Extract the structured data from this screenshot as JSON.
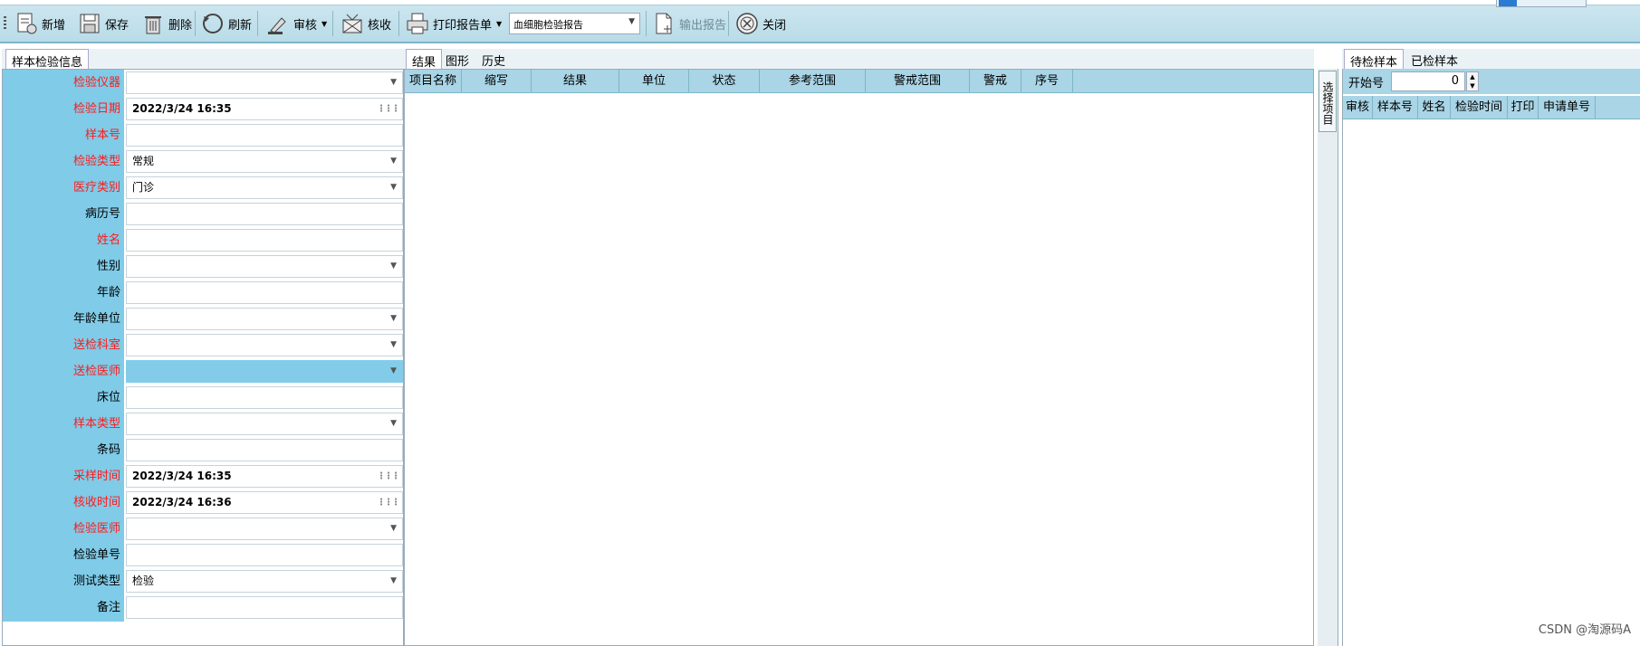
{
  "toolbar": {
    "buttons": [
      {
        "label": "新增",
        "icon": "new-doc-icon"
      },
      {
        "label": "保存",
        "icon": "save-icon"
      },
      {
        "label": "删除",
        "icon": "trash-icon"
      },
      {
        "label": "刷新",
        "icon": "refresh-icon"
      },
      {
        "label": "审核",
        "icon": "review-stamp-icon"
      },
      {
        "label": "核收",
        "icon": "receive-icon"
      },
      {
        "label": "打印报告单",
        "icon": "printer-icon"
      },
      {
        "label": "输出报告",
        "icon": "export-doc-icon"
      },
      {
        "label": "关闭",
        "icon": "close-circle-icon"
      }
    ],
    "report_select": "血细胞检验报告"
  },
  "left": {
    "tab": "样本检验信息",
    "fields": [
      {
        "label": "检验仪器",
        "value": "",
        "required": true,
        "type": "select"
      },
      {
        "label": "检验日期",
        "value": "2022/3/24 16:35",
        "required": true,
        "type": "date"
      },
      {
        "label": "样本号",
        "value": "",
        "required": true,
        "type": "text"
      },
      {
        "label": "检验类型",
        "value": "常规",
        "required": true,
        "type": "select"
      },
      {
        "label": "医疗类别",
        "value": "门诊",
        "required": true,
        "type": "select"
      },
      {
        "label": "病历号",
        "value": "",
        "required": false,
        "type": "text"
      },
      {
        "label": "姓名",
        "value": "",
        "required": true,
        "type": "text"
      },
      {
        "label": "性别",
        "value": "",
        "required": false,
        "type": "select"
      },
      {
        "label": "年龄",
        "value": "",
        "required": false,
        "type": "text"
      },
      {
        "label": "年龄单位",
        "value": "",
        "required": false,
        "type": "select"
      },
      {
        "label": "送检科室",
        "value": "",
        "required": true,
        "type": "select"
      },
      {
        "label": "送检医师",
        "value": "",
        "required": true,
        "type": "select",
        "highlight": true
      },
      {
        "label": "床位",
        "value": "",
        "required": false,
        "type": "text"
      },
      {
        "label": "样本类型",
        "value": "",
        "required": true,
        "type": "select"
      },
      {
        "label": "条码",
        "value": "",
        "required": false,
        "type": "text"
      },
      {
        "label": "采样时间",
        "value": "2022/3/24 16:35",
        "required": true,
        "type": "date"
      },
      {
        "label": "核收时间",
        "value": "2022/3/24 16:36",
        "required": true,
        "type": "date"
      },
      {
        "label": "检验医师",
        "value": "",
        "required": true,
        "type": "select"
      },
      {
        "label": "检验单号",
        "value": "",
        "required": false,
        "type": "text"
      },
      {
        "label": "测试类型",
        "value": "检验",
        "required": false,
        "type": "select"
      },
      {
        "label": "备注",
        "value": "",
        "required": false,
        "type": "text"
      }
    ]
  },
  "middle": {
    "tabs": [
      "结果",
      "图形",
      "历史"
    ],
    "columns": [
      "项目名称",
      "缩写",
      "结果",
      "单位",
      "状态",
      "参考范围",
      "警戒范围",
      "警戒",
      "序号"
    ],
    "side_button": "选择项目"
  },
  "right": {
    "tabs": [
      "待检样本",
      "已检样本"
    ],
    "start_label": "开始号",
    "start_value": "0",
    "columns": [
      "审核",
      "样本号",
      "姓名",
      "检验时间",
      "打印",
      "申请单号"
    ]
  },
  "watermark": "CSDN @淘源码A"
}
